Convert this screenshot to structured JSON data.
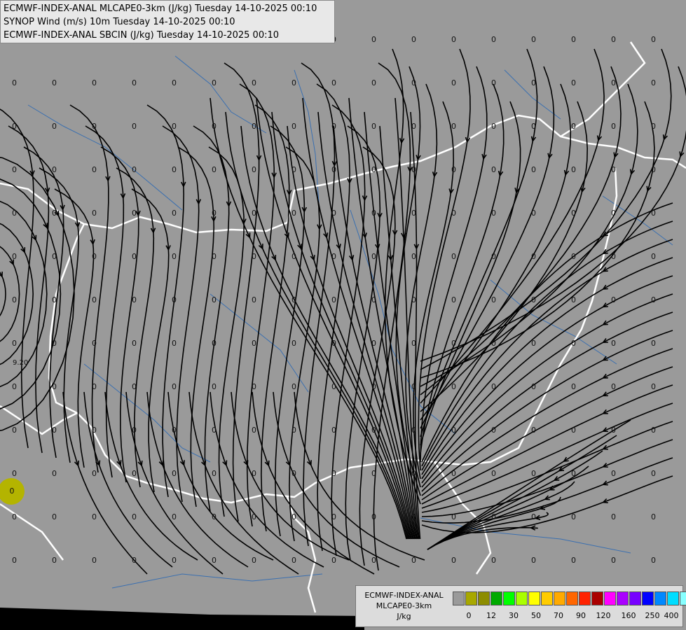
{
  "title_lines": [
    "ECMWF-INDEX-ANAL MLCAPE0-3km (J/kg) Tuesday 14-10-2025 00:10",
    "SYNOP Wind (m/s) 10m Tuesday 14-10-2025 00:10",
    "ECMWF-INDEX-ANAL SBCIN (J/kg) Tuesday 14-10-2025 00:10"
  ],
  "map": {
    "background_color": "#9a9a9a",
    "border_color": "#ffffff",
    "river_color": "#3a6fb0",
    "streamline_color": "#000000",
    "grid_value_label": "0",
    "station_label": "9.20",
    "highlight_label": "0",
    "highlight_color": "#b4b400"
  },
  "legend": {
    "line1": "ECMWF-INDEX-ANAL",
    "line2": "MLCAPE0-3km",
    "units": "J/kg",
    "colors": [
      "#9a9a9a",
      "#a8a800",
      "#8c8c00",
      "#00aa00",
      "#00ff00",
      "#aaff00",
      "#ffff00",
      "#ffcc00",
      "#ffaa00",
      "#ff6600",
      "#ff2200",
      "#aa0000",
      "#ff00ff",
      "#aa00ff",
      "#7700ff",
      "#0000ff",
      "#0088ff",
      "#00ddff",
      "#88ffff",
      "#ffffff"
    ],
    "ticks": [
      "0",
      "12",
      "30",
      "50",
      "70",
      "90",
      "120",
      "160",
      "250",
      "400"
    ]
  }
}
